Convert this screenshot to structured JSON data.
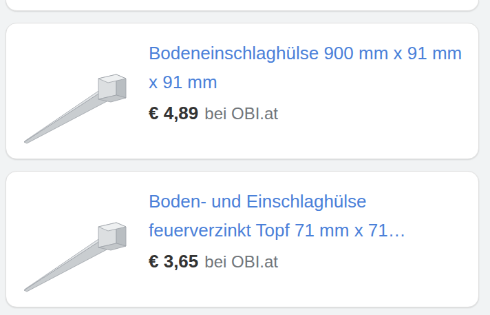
{
  "products": [
    {
      "title": "Bodeneinschlaghülse 900 mm x 91 mm x 91 mm",
      "price": "€ 4,89",
      "seller": "bei OBI.at"
    },
    {
      "title": "Boden- und Einschlaghülse feuerverzinkt Topf 71 mm x 71…",
      "price": "€ 3,65",
      "seller": "bei OBI.at"
    }
  ]
}
